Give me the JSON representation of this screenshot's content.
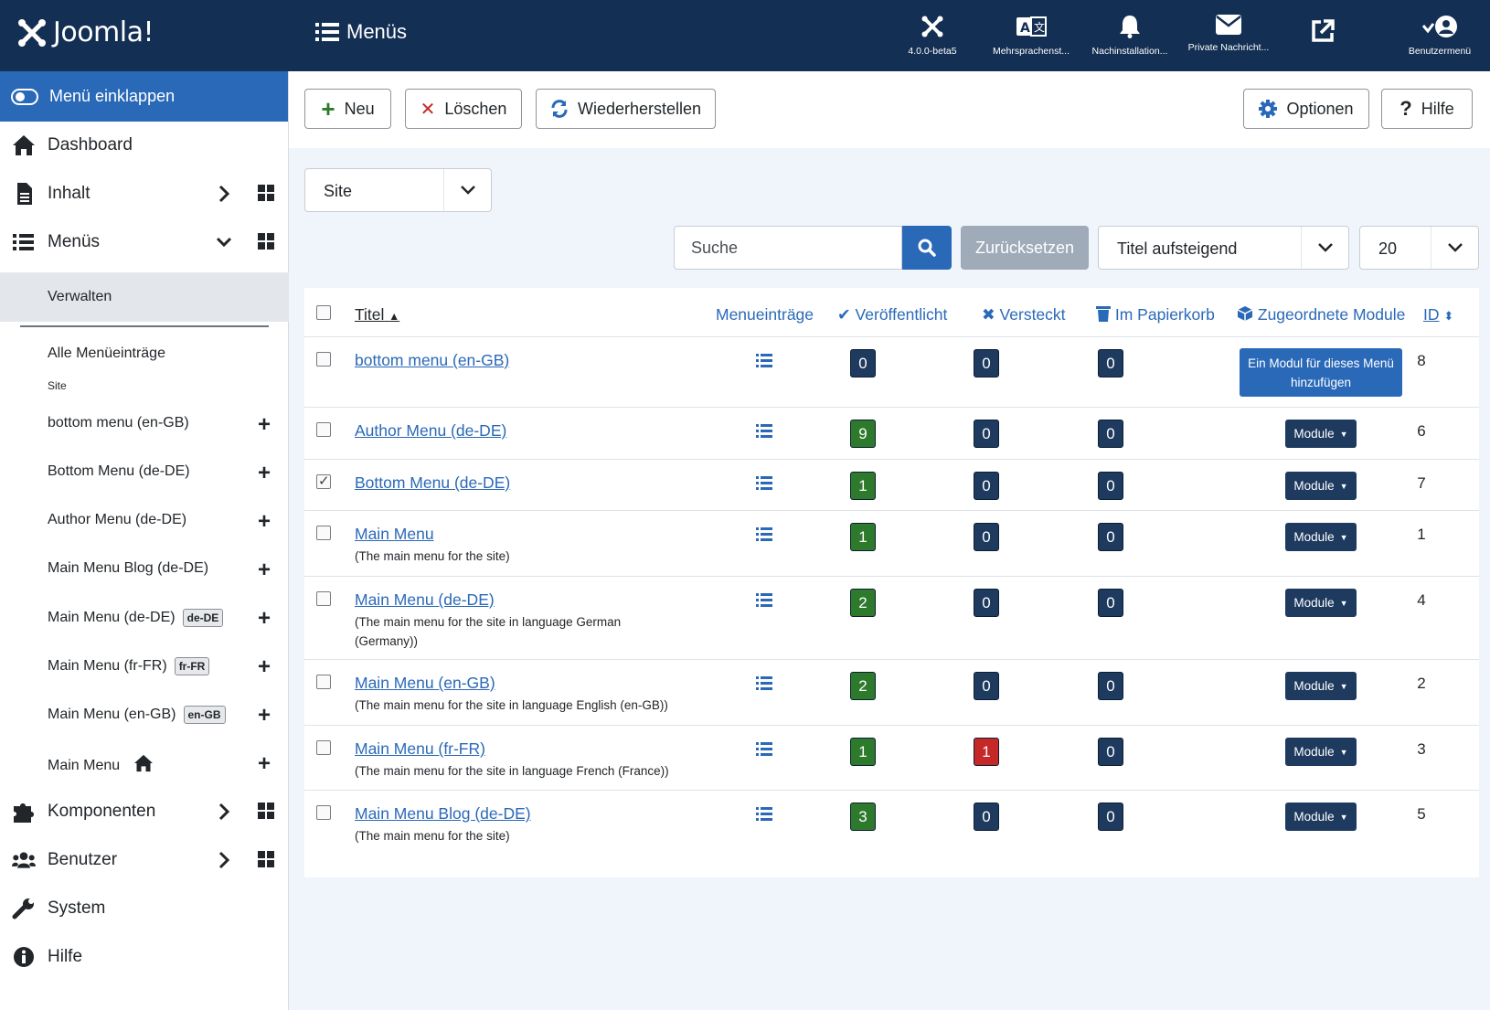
{
  "header": {
    "logo_text": "Joomla!",
    "page_title": "Menüs",
    "items": [
      {
        "label": "4.0.0-beta5",
        "icon": "joomla-icon"
      },
      {
        "label": "Mehrsprachenst...",
        "icon": "language-icon"
      },
      {
        "label": "Nachinstallation...",
        "icon": "bell-icon"
      },
      {
        "label": "Private Nachricht...",
        "icon": "envelope-icon"
      },
      {
        "label": "",
        "icon": "external-link-icon"
      },
      {
        "label": "Benutzermenü",
        "icon": "user-icon"
      }
    ]
  },
  "sidebar": {
    "collapse_label": "Menü einklappen",
    "dashboard": "Dashboard",
    "content": "Inhalt",
    "menus": "Menüs",
    "manage": "Verwalten",
    "all_items": "Alle Menüeinträge",
    "site_heading": "Site",
    "menu_items": [
      {
        "label": "bottom menu (en-GB)",
        "badge": ""
      },
      {
        "label": "Bottom Menu (de-DE)",
        "badge": ""
      },
      {
        "label": "Author Menu (de-DE)",
        "badge": ""
      },
      {
        "label": "Main Menu Blog (de-DE)",
        "badge": ""
      },
      {
        "label": "Main Menu (de-DE)",
        "badge": "de-DE"
      },
      {
        "label": "Main Menu (fr-FR)",
        "badge": "fr-FR"
      },
      {
        "label": "Main Menu (en-GB)",
        "badge": "en-GB"
      },
      {
        "label": "Main Menu",
        "badge": ""
      }
    ],
    "components": "Komponenten",
    "users": "Benutzer",
    "system": "System",
    "help": "Hilfe"
  },
  "toolbar": {
    "new": "Neu",
    "delete": "Löschen",
    "restore": "Wiederherstellen",
    "options": "Optionen",
    "help": "Hilfe"
  },
  "filters": {
    "client": "Site",
    "search_placeholder": "Suche",
    "reset": "Zurücksetzen",
    "sort": "Titel aufsteigend",
    "limit": "20"
  },
  "table": {
    "headers": {
      "title": "Titel",
      "items": "Menueinträge",
      "published": "Veröffentlicht",
      "hidden": "Versteckt",
      "trashed": "Im Papierkorb",
      "modules": "Zugeordnete Module",
      "id": "ID"
    },
    "module_button": "Module",
    "add_module": "Ein Modul für dieses Menü hinzufügen",
    "rows": [
      {
        "title": "bottom menu (en-GB)",
        "desc": "",
        "published": "0",
        "hidden": "0",
        "trashed": "0",
        "id": "8",
        "checked": false
      },
      {
        "title": "Author Menu (de-DE)",
        "desc": "",
        "published": "9",
        "hidden": "0",
        "trashed": "0",
        "id": "6",
        "checked": false
      },
      {
        "title": "Bottom Menu (de-DE)",
        "desc": "",
        "published": "1",
        "hidden": "0",
        "trashed": "0",
        "id": "7",
        "checked": true
      },
      {
        "title": "Main Menu",
        "desc": "(The main menu for the site)",
        "published": "1",
        "hidden": "0",
        "trashed": "0",
        "id": "1",
        "checked": false
      },
      {
        "title": "Main Menu (de-DE)",
        "desc": "(The main menu for the site in language German (Germany))",
        "published": "2",
        "hidden": "0",
        "trashed": "0",
        "id": "4",
        "checked": false
      },
      {
        "title": "Main Menu (en-GB)",
        "desc": "(The main menu for the site in language English (en-GB))",
        "published": "2",
        "hidden": "0",
        "trashed": "0",
        "id": "2",
        "checked": false
      },
      {
        "title": "Main Menu (fr-FR)",
        "desc": "(The main menu for the site in language French (France))",
        "published": "1",
        "hidden": "1",
        "trashed": "0",
        "id": "3",
        "checked": false
      },
      {
        "title": "Main Menu Blog (de-DE)",
        "desc": "(The main menu for the site)",
        "published": "3",
        "hidden": "0",
        "trashed": "0",
        "id": "5",
        "checked": false
      }
    ]
  },
  "colors": {
    "header_bg": "#132f53",
    "accent": "#2a69b8",
    "published_green": "#2d7a2d",
    "hidden_red": "#c52827",
    "count_dark": "#1e3a5f"
  }
}
